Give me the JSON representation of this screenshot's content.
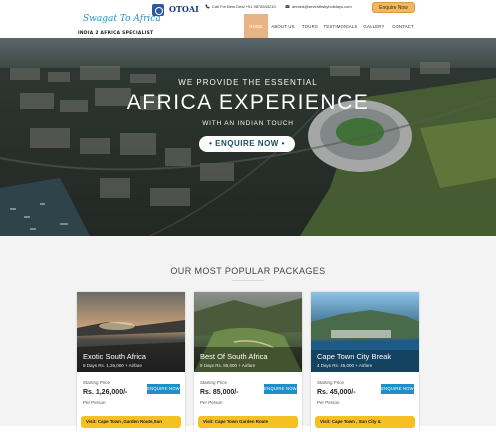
{
  "header": {
    "logo_script": "Swagat To Africa",
    "logo_tagline": "INDIA 2 AFRICA SPECIALIST",
    "affiliation_logo": "OTOAI",
    "phone": "Call For Best Deal +91 9876543210",
    "email": "ahmed@seventhskyholidays.com",
    "enquire_button": "Enquire Now",
    "nav": [
      "HOME",
      "ABOUT US",
      "TOURS",
      "TESTIMONIALS",
      "GALLERY",
      "CONTACT"
    ],
    "active_nav": "HOME",
    "active_color": "#e8b483",
    "icons": {
      "phone": "phone-icon",
      "email": "mail-icon"
    }
  },
  "hero": {
    "line1": "WE PROVIDE THE ESSENTIAL",
    "line2": "AFRICA EXPERIENCE",
    "line3": "WITH AN INDIAN TOUCH",
    "button": "• ENQUIRE NOW •"
  },
  "packages": {
    "title": "OUR MOST POPULAR PACKAGES",
    "cards": [
      {
        "title": "Exotic South Africa",
        "duration": "9 Days Rs. 1,26,000 + Airfare",
        "price_label": "Starting Price",
        "price": "Rs. 1,26,000/-",
        "per": "Per Person",
        "button": "ENQUIRE NOW",
        "visit": "Visit: Cape Town ,Garden Route,Sun"
      },
      {
        "title": "Best Of South Africa",
        "duration": "8 Days Rs. 85,000 + Airfare",
        "price_label": "Starting Price",
        "price": "Rs. 85,000/-",
        "per": "Per Person",
        "button": "ENQUIRE NOW",
        "visit": "Visit: Cape Town Garden Route"
      },
      {
        "title": "Cape Town City Break",
        "duration": "4 Days Rs. 45,000 + Airfare",
        "price_label": "Starting Price",
        "price": "Rs. 45,000/-",
        "per": "Per Person",
        "button": "ENQUIRE NOW",
        "visit": "Visit: Cape Town , Sun City &"
      }
    ],
    "accent_button_color": "#1f8fcc",
    "visit_bar_color": "#f5c021"
  }
}
